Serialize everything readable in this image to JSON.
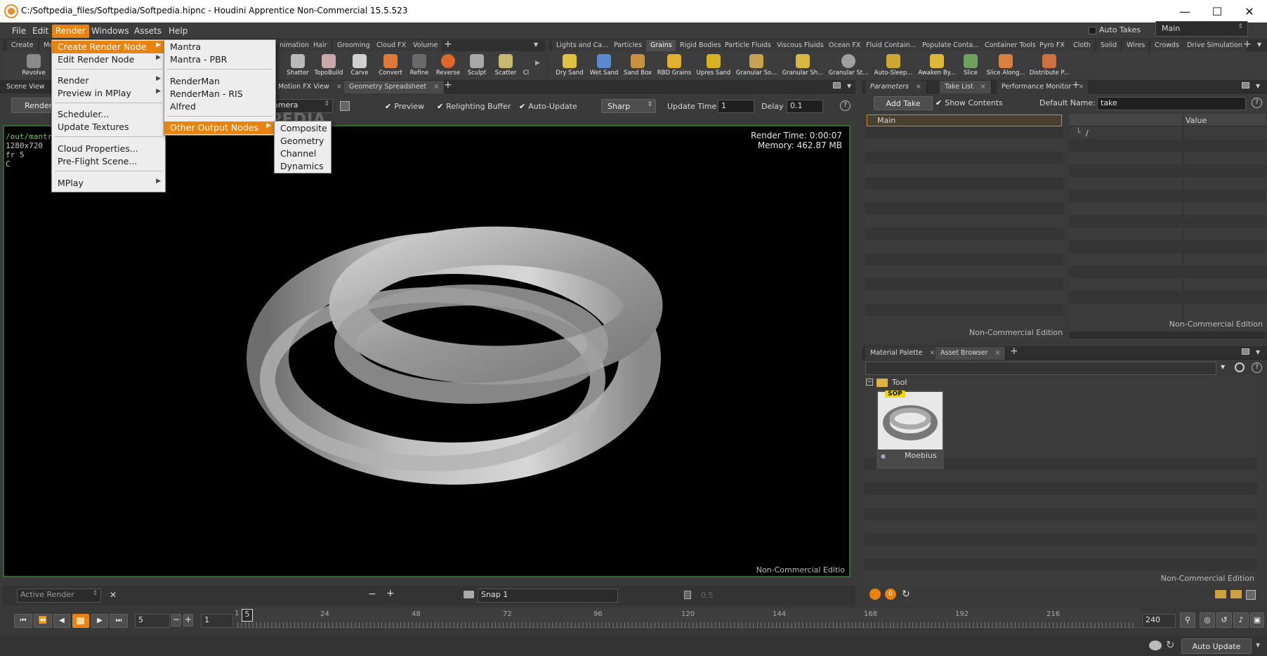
{
  "window": {
    "title": "C:/Softpedia_files/Softpedia/Softpedia.hipnc - Houdini Apprentice Non-Commercial 15.5.523",
    "minimize": "—",
    "maximize": "☐",
    "close": "✕"
  },
  "menubar": {
    "items": [
      "File",
      "Edit",
      "Render",
      "Windows",
      "Assets",
      "Help"
    ],
    "auto_takes": "Auto Takes",
    "take_select": "Main"
  },
  "render_menu": {
    "items": [
      "Create Render Node",
      "Edit Render Node",
      "Render",
      "Preview in MPlay",
      "Scheduler...",
      "Update Textures",
      "Cloud Properties...",
      "Pre-Flight Scene...",
      "MPlay"
    ]
  },
  "create_render_node_menu": {
    "items": [
      "Mantra",
      "Mantra - PBR",
      "RenderMan",
      "RenderMan - RIS",
      "Alfred",
      "Other Output Nodes"
    ]
  },
  "other_output_menu": {
    "items": [
      "Composite",
      "Geometry",
      "Channel",
      "Dynamics"
    ]
  },
  "left_shelf": {
    "tabs": [
      "Create",
      "Mo",
      "nimation",
      "Hair",
      "Grooming",
      "Cloud FX",
      "Volume"
    ],
    "tools": [
      "Revolve",
      "Shatter",
      "TopoBuild",
      "Carve",
      "Convert",
      "Refine",
      "Reverse",
      "Sculpt",
      "Scatter",
      "Cl"
    ]
  },
  "right_shelf": {
    "tabs": [
      "Lights and Ca...",
      "Particles",
      "Grains",
      "Rigid Bodies",
      "Particle Fluids",
      "Viscous Fluids",
      "Ocean FX",
      "Fluid Contain...",
      "Populate Conta...",
      "Container Tools",
      "Pyro FX",
      "Cloth",
      "Solid",
      "Wires",
      "Crowds",
      "Drive Simulation"
    ],
    "tools": [
      "Dry Sand",
      "Wet Sand",
      "Sand Box",
      "RBD Grains",
      "Upres Sand",
      "Granular So...",
      "Granular Sh...",
      "Granular St...",
      "Auto-Sleep...",
      "Awaken By...",
      "Slice",
      "Slice Along...",
      "Distribute P..."
    ]
  },
  "viewer": {
    "tabs": [
      "Scene View",
      "Motion FX View",
      "Geometry Spreadsheet"
    ],
    "render_button": "Render",
    "camera": "amera",
    "preview": "Preview",
    "relighting": "Relighting Buffer",
    "auto_update": "Auto-Update",
    "sharp": "Sharp",
    "update_time_label": "Update Time",
    "update_time_value": "1",
    "delay_label": "Delay",
    "delay_value": "0.1",
    "info_lines": [
      "/out/mantra",
      "1280x720",
      "fr 5",
      "C"
    ],
    "render_time": "Render Time: 0:00:07",
    "memory": "Memory:   462.87 MB",
    "watermark": "Non-Commercial Editio",
    "active_render": "Active Render",
    "snap_label": "Snap",
    "snap_value": "1",
    "zoom_value": "0.5"
  },
  "takes_pane": {
    "tabs": [
      "Parameters",
      "Take List",
      "Performance Monitor"
    ],
    "add_take": "Add Take",
    "show_contents": "Show Contents",
    "default_name_label": "Default Name:",
    "default_name_value": "take",
    "main_take": "Main",
    "value_header": "Value",
    "root_path": "/",
    "watermark_left": "Non-Commercial Edition",
    "watermark_right": "Non-Commercial Edition"
  },
  "asset_pane": {
    "tabs": [
      "Material Palette",
      "Asset Browser"
    ],
    "folder": "Tool",
    "asset_badge": "SOP",
    "asset_name": "Moebius",
    "watermark": "Non-Commercial Edition"
  },
  "timeline": {
    "frame": "5",
    "start": "1",
    "end": "240",
    "ticks": [
      "24",
      "48",
      "72",
      "96",
      "120",
      "144",
      "168",
      "192",
      "216"
    ],
    "marker_start": "1",
    "marker_current": "5"
  },
  "statusbar": {
    "auto_update": "Auto Update"
  },
  "overlay_watermark": "SOFTPEDIA",
  "colors": {
    "accent": "#e8830f",
    "viewport_border": "#2f6b2a",
    "panel": "#3a3a3a"
  }
}
